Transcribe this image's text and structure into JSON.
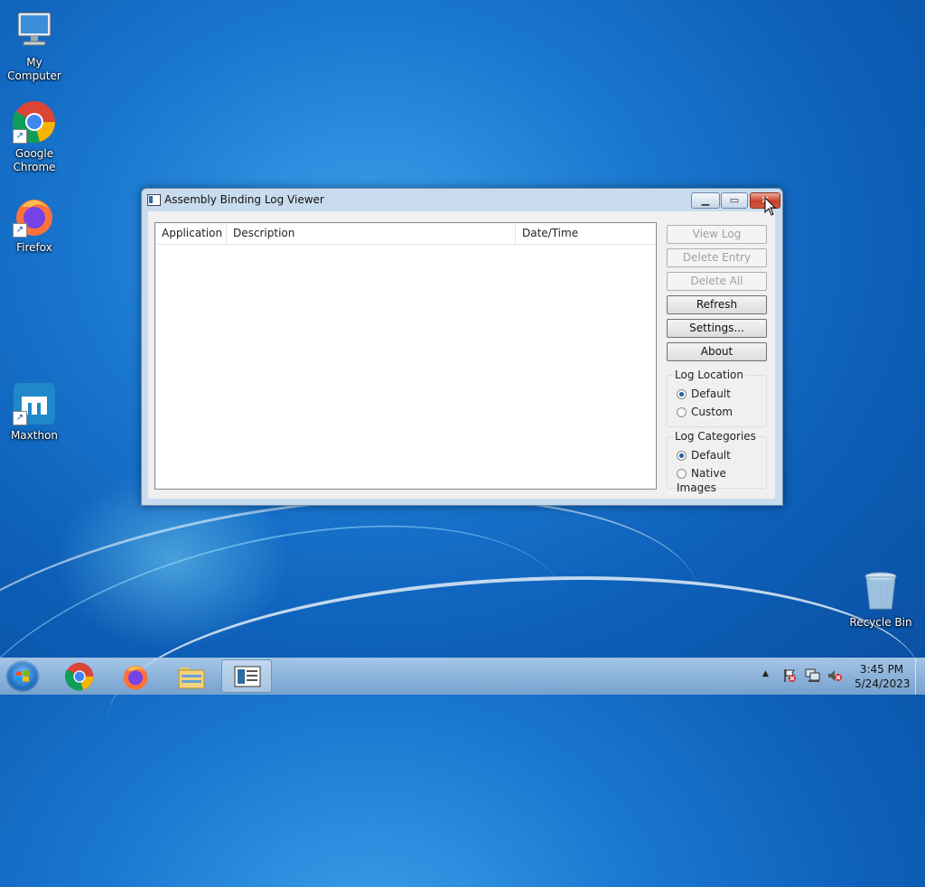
{
  "desktop": {
    "icons": [
      {
        "label": "My Computer"
      },
      {
        "label": "Google Chrome"
      },
      {
        "label": "Firefox"
      },
      {
        "label": "Maxthon"
      },
      {
        "label": "Recycle Bin"
      }
    ]
  },
  "window": {
    "title": "Assembly Binding Log Viewer",
    "caption_buttons": {
      "minimize": "minimize-icon",
      "maximize": "maximize-icon",
      "close": "close-icon"
    },
    "list": {
      "columns": [
        "Application",
        "Description",
        "Date/Time"
      ],
      "rows": []
    },
    "buttons": {
      "view_log": "View Log",
      "delete_entry": "Delete Entry",
      "delete_all": "Delete All",
      "refresh": "Refresh",
      "settings": "Settings...",
      "about": "About"
    },
    "log_location": {
      "legend": "Log Location",
      "options": [
        "Default",
        "Custom"
      ],
      "selected": "Default"
    },
    "log_categories": {
      "legend": "Log Categories",
      "options": [
        "Default",
        "Native Images"
      ],
      "selected": "Default"
    }
  },
  "taskbar": {
    "items": [
      "start-button",
      "chrome",
      "firefox",
      "file-explorer",
      "assembly-binding-log-viewer"
    ],
    "active_item": "assembly-binding-log-viewer",
    "clock": {
      "time": "3:45 PM",
      "date": "5/24/2023"
    }
  },
  "colors": {
    "desktop_blue": "#1a78d0",
    "close_button_red": "#c8412a",
    "window_frame": "#c9dcef"
  }
}
